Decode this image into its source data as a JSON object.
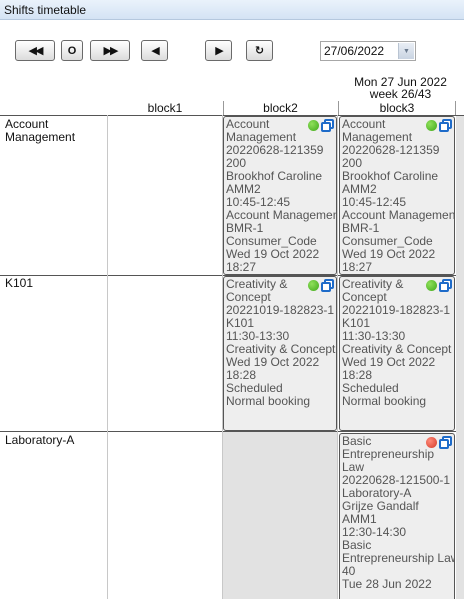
{
  "window": {
    "title": "Shifts timetable"
  },
  "toolbar": {
    "first_label": "◀◀",
    "today_label": "O",
    "last_label": "▶▶",
    "prev_label": "◀",
    "next_label": "▶",
    "refresh_label": "↻",
    "date_value": "27/06/2022"
  },
  "day_header": {
    "date": "Mon 27 Jun 2022",
    "week": "week 26/43"
  },
  "columns": [
    "block1",
    "block2",
    "block3"
  ],
  "rows": [
    "Account Management",
    "K101",
    "Laboratory-A"
  ],
  "cards": {
    "acc_b2": [
      "Account",
      "Management",
      "20220628-121359",
      "200",
      "Brookhof Caroline",
      "AMM2",
      "10:45-12:45",
      "Account Management",
      "BMR-1",
      "Consumer_Code",
      "Wed 19 Oct 2022",
      "18:27"
    ],
    "acc_b3": [
      "Account",
      "Management",
      "20220628-121359",
      "200",
      "Brookhof Caroline",
      "AMM2",
      "10:45-12:45",
      "Account Management",
      "BMR-1",
      "Consumer_Code",
      "Wed 19 Oct 2022",
      "18:27"
    ],
    "k101_b2": [
      "Creativity &",
      "Concept",
      "20221019-182823-1",
      "K101",
      "11:30-13:30",
      "Creativity & Concept",
      "Wed 19 Oct 2022",
      "18:28",
      "Scheduled",
      "Normal booking"
    ],
    "k101_b3": [
      "Creativity &",
      "Concept",
      "20221019-182823-1",
      "K101",
      "11:30-13:30",
      "Creativity & Concept",
      "Wed 19 Oct 2022",
      "18:28",
      "Scheduled",
      "Normal booking"
    ],
    "lab_b3": [
      "Basic",
      "Entrepreneurship",
      "Law",
      "20220628-121500-1",
      "Laboratory-A",
      "Grijze Gandalf",
      "AMM1",
      "12:30-14:30",
      "Basic",
      "Entrepreneurship Law",
      "40",
      "Tue 28 Jun 2022"
    ]
  },
  "status_colors": {
    "ok": "#3fa81a",
    "conflict": "#d43a28",
    "copy_icon": "#1e6bc9"
  }
}
